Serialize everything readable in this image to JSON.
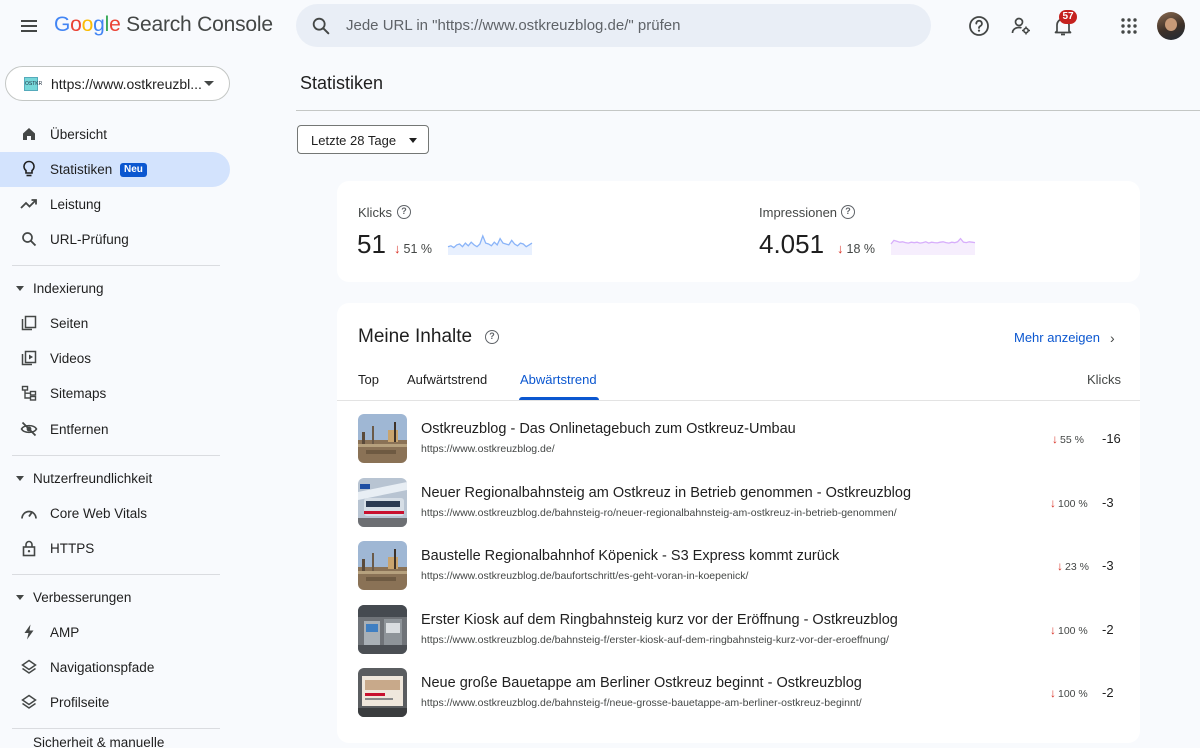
{
  "header": {
    "app_name_prefix": [
      "G",
      "o",
      "o",
      "g",
      "l",
      "e"
    ],
    "app_name_rest": " Search Console",
    "search_placeholder": "Jede URL in \"https://www.ostkreuzblog.de/\" prüfen",
    "notifications_count": "57"
  },
  "sidebar": {
    "property": "https://www.ostkreuzbl...",
    "property_favicon_text": "OSTKR",
    "items_top": [
      {
        "label": "Übersicht",
        "icon": "home-icon"
      },
      {
        "label": "Statistiken",
        "icon": "lightbulb-icon",
        "badge": "Neu",
        "active": true
      },
      {
        "label": "Leistung",
        "icon": "trending-up-icon"
      },
      {
        "label": "URL-Prüfung",
        "icon": "search-icon"
      }
    ],
    "sections": [
      {
        "title": "Indexierung",
        "items": [
          {
            "label": "Seiten",
            "icon": "pages-icon"
          },
          {
            "label": "Videos",
            "icon": "video-icon"
          },
          {
            "label": "Sitemaps",
            "icon": "sitemap-icon"
          },
          {
            "label": "Entfernen",
            "icon": "eye-off-icon"
          }
        ]
      },
      {
        "title": "Nutzerfreundlichkeit",
        "items": [
          {
            "label": "Core Web Vitals",
            "icon": "speed-icon"
          },
          {
            "label": "HTTPS",
            "icon": "lock-icon"
          }
        ]
      },
      {
        "title": "Verbesserungen",
        "items": [
          {
            "label": "AMP",
            "icon": "bolt-icon"
          },
          {
            "label": "Navigationspfade",
            "icon": "layers-icon"
          },
          {
            "label": "Profilseite",
            "icon": "layers-icon"
          }
        ]
      },
      {
        "title": "Sicherheit & manuelle",
        "items": []
      }
    ]
  },
  "main": {
    "title": "Statistiken",
    "range": "Letzte 28 Tage",
    "metrics": [
      {
        "label": "Klicks",
        "value": "51",
        "delta": "51 %",
        "spark_color": "#8ab4f8",
        "spark_fill": "#e8f0fe",
        "spark": [
          0.35,
          0.4,
          0.3,
          0.45,
          0.5,
          0.35,
          0.55,
          0.4,
          0.6,
          0.45,
          0.35,
          0.5,
          0.95,
          0.55,
          0.5,
          0.4,
          0.6,
          0.45,
          0.8,
          0.55,
          0.5,
          0.45,
          0.7,
          0.5,
          0.4,
          0.55,
          0.5,
          0.35,
          0.45,
          0.55
        ]
      },
      {
        "label": "Impressionen",
        "value": "4.051",
        "delta": "18 %",
        "spark_color": "#d7aefb",
        "spark_fill": "#f6eefd",
        "spark": [
          0.5,
          0.7,
          0.65,
          0.6,
          0.62,
          0.58,
          0.55,
          0.6,
          0.57,
          0.6,
          0.55,
          0.58,
          0.62,
          0.55,
          0.6,
          0.58,
          0.56,
          0.6,
          0.62,
          0.58,
          0.55,
          0.6,
          0.57,
          0.62,
          0.8,
          0.6,
          0.58,
          0.62,
          0.6,
          0.58
        ]
      }
    ],
    "content": {
      "title": "Meine Inhalte",
      "more_label": "Mehr anzeigen",
      "tabs": [
        "Top",
        "Aufwärtstrend",
        "Abwärtstrend"
      ],
      "active_tab": 2,
      "column_header": "Klicks",
      "rows": [
        {
          "title": "Ostkreuzblog - Das Onlinetagebuch zum Ostkreuz-Umbau",
          "url": "https://www.ostkreuzblog.de/",
          "delta": "55 %",
          "value": "-16",
          "thumb": "construction"
        },
        {
          "title": "Neuer Regionalbahnsteig am Ostkreuz in Betrieb genommen - Ostkreuzblog",
          "url": "https://www.ostkreuzblog.de/bahnsteig-ro/neuer-regionalbahnsteig-am-ostkreuz-in-betrieb-genommen/",
          "delta": "100 %",
          "value": "-3",
          "thumb": "train"
        },
        {
          "title": "Baustelle Regionalbahnhof Köpenick - S3 Express kommt zurück",
          "url": "https://www.ostkreuzblog.de/baufortschritt/es-geht-voran-in-koepenick/",
          "delta": "23 %",
          "value": "-3",
          "thumb": "construction"
        },
        {
          "title": "Erster Kiosk auf dem Ringbahnsteig kurz vor der Eröffnung - Ostkreuzblog",
          "url": "https://www.ostkreuzblog.de/bahnsteig-f/erster-kiosk-auf-dem-ringbahnsteig-kurz-vor-der-eroeffnung/",
          "delta": "100 %",
          "value": "-2",
          "thumb": "station"
        },
        {
          "title": "Neue große Bauetappe am Berliner Ostkreuz beginnt - Ostkreuzblog",
          "url": "https://www.ostkreuzblog.de/bahnsteig-f/neue-grosse-bauetappe-am-berliner-ostkreuz-beginnt/",
          "delta": "100 %",
          "value": "-2",
          "thumb": "sign"
        }
      ]
    }
  }
}
